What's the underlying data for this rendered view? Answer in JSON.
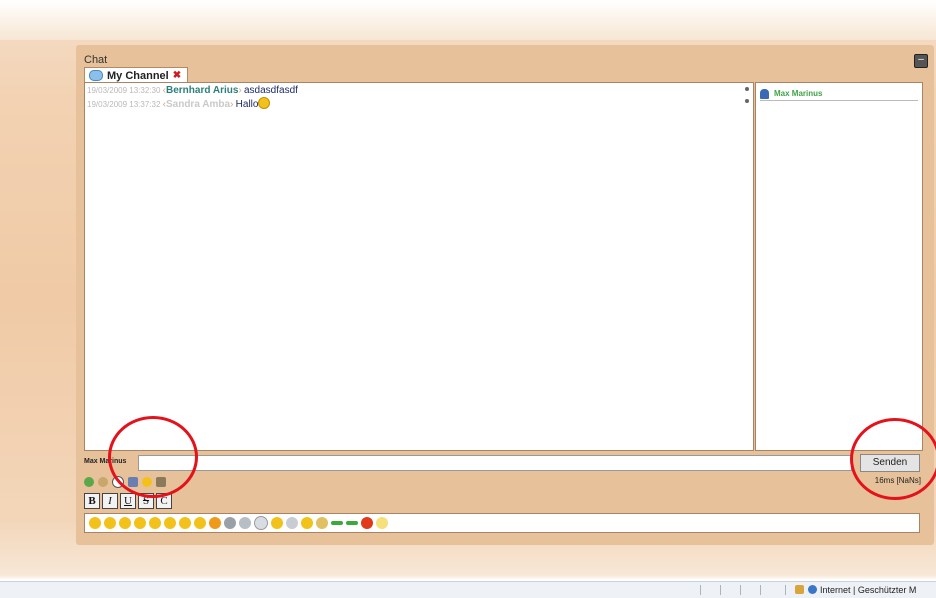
{
  "chat": {
    "title": "Chat",
    "minimize": "–",
    "tab_label": "My Channel",
    "tab_close": "✖",
    "messages": [
      {
        "time": "19/03/2009 13:32:30",
        "nick": "Bernhard Arius",
        "text": "asdasdfasdf"
      },
      {
        "time": "19/03/2009 13:37:32",
        "nick": "Sandra Amba",
        "text": "Hallo"
      }
    ],
    "online_user": "Max Marinus"
  },
  "input": {
    "label": "Max Marinus",
    "send_label": "Senden",
    "latency": "16ms [NaNs]"
  },
  "format_buttons": [
    "B",
    "I",
    "U",
    "S",
    "C"
  ],
  "statusbar": {
    "text": "Internet | Geschützter M"
  },
  "colors": {
    "annotation_circle": "#e3121b",
    "panel": "#e7c19a"
  },
  "icons": {
    "tools": [
      "color-icon",
      "settings-icon",
      "help-icon",
      "sound-icon",
      "smiley-icon",
      "user-icon"
    ],
    "emojis": [
      "smile",
      "grin",
      "wink",
      "laugh",
      "tongue",
      "surprised",
      "sad",
      "cool",
      "angry",
      "confused",
      "sleep",
      "neutral",
      "cry",
      "cloud",
      "sun",
      "idea",
      "arrow-right",
      "arrow-left",
      "stop",
      "bulb"
    ]
  }
}
